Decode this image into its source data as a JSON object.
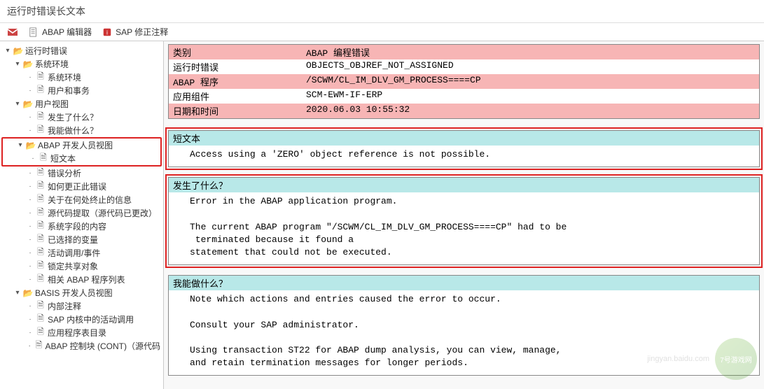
{
  "title": "运行时错误长文本",
  "toolbar": {
    "mail": "",
    "abap_editor": "ABAP 编辑器",
    "sap_note": "SAP 修正注释"
  },
  "tree": {
    "root": "运行时错误",
    "sys_env_folder": "系统环境",
    "sys_env": "系统环境",
    "user_tx": "用户和事务",
    "user_view_folder": "用户视图",
    "what_happened": "发生了什么？",
    "what_can_do": "我能做什么？",
    "abap_dev_folder": "ABAP 开发人员视图",
    "short_text": "短文本",
    "error_analysis": "错误分析",
    "how_fix": "如何更正此错误",
    "where_terminated": "关于在何处终止的信息",
    "source_extract": "源代码提取（源代码已更改）",
    "sys_fields": "系统字段的内容",
    "chosen_vars": "已选择的变量",
    "active_calls": "活动调用/事件",
    "lock_shared": "锁定共享对象",
    "abap_prog_list": "相关 ABAP 程序列表",
    "basis_dev_folder": "BASIS 开发人员视图",
    "internal_notes": "内部注释",
    "kernel_calls": "SAP 内核中的活动调用",
    "app_prog_dir": "应用程序表目录",
    "abap_cont": "ABAP 控制块 (CONT)（源代码"
  },
  "info": {
    "category_label": "类别",
    "category_value": "ABAP 编程错误",
    "runtime_error_label": "运行时错误",
    "runtime_error_value": "OBJECTS_OBJREF_NOT_ASSIGNED",
    "abap_program_label": "ABAP 程序",
    "abap_program_value": "/SCWM/CL_IM_DLV_GM_PROCESS====CP",
    "app_component_label": "应用组件",
    "app_component_value": "SCM-EWM-IF-ERP",
    "date_time_label": "日期和时间",
    "date_time_value": "2020.06.03 10:55:32"
  },
  "sections": {
    "short_text": {
      "header": "短文本",
      "body": "Access using a 'ZERO' object reference is not possible."
    },
    "what_happened": {
      "header": "发生了什么？",
      "body": "Error in the ABAP application program.\n\nThe current ABAP program \"/SCWM/CL_IM_DLV_GM_PROCESS====CP\" had to be\n terminated because it found a\nstatement that could not be executed."
    },
    "what_can": {
      "header": "我能做什么？",
      "body": "Note which actions and entries caused the error to occur.\n\nConsult your SAP administrator.\n\nUsing transaction ST22 for ABAP dump analysis, you can view, manage,\nand retain termination messages for longer periods."
    }
  },
  "watermark": {
    "site": "jingyan.baidu.com",
    "logo": "7号游戏网"
  }
}
